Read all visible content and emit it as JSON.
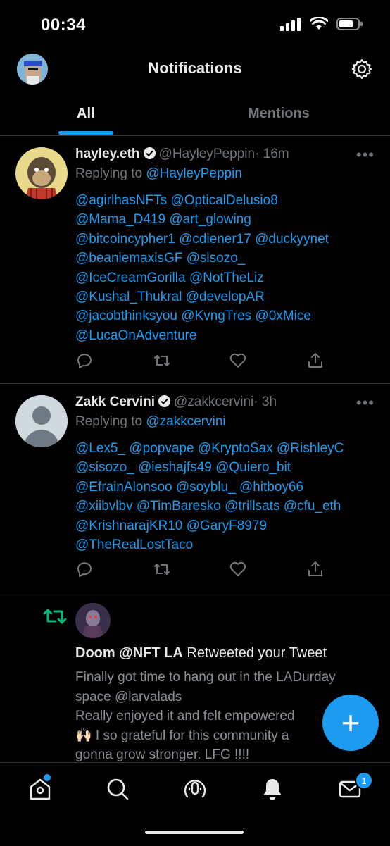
{
  "status_bar": {
    "time": "00:34"
  },
  "header": {
    "title": "Notifications"
  },
  "tabs": [
    {
      "label": "All"
    },
    {
      "label": "Mentions"
    }
  ],
  "tweets": [
    {
      "name": "hayley.eth",
      "handle": "@HayleyPeppin",
      "time": "· 16m",
      "replying_prefix": "Replying to ",
      "replying_to": "@HayleyPeppin",
      "text": "@agirlhasNFTs @OpticalDelusio8\n@Mama_D419 @art_glowing\n@bitcoincypher1 @cdiener17 @duckyynet\n@beaniemaxisGF @sisozo_\n@IceCreamGorilla @NotTheLiz\n@Kushal_Thukral @developAR\n@jacobthinksyou @KvngTres @0xMice\n@LucaOnAdventure"
    },
    {
      "name": "Zakk Cervini",
      "handle": "@zakkcervini",
      "time": "· 3h",
      "replying_prefix": "Replying to ",
      "replying_to": "@zakkcervini",
      "text": "@Lex5_ @popvape @KryptoSax @RishleyC\n@sisozo_ @ieshajfs49 @Quiero_bit\n@EfrainAlonsoo @soyblu_ @hitboy66\n@xiibvlbv @TimBaresko @trillsats @cfu_eth\n@KrishnarajKR10 @GaryF8979\n@TheRealLostTaco"
    }
  ],
  "retweet": {
    "user": "Doom @NFT LA",
    "action": " Retweeted your Tweet",
    "text": "Finally got time to hang out in the LADurday\nspace @larvalads\nReally enjoyed it and felt empowered\n🙌🏻 I  so grateful for this community a\ngonna grow stronger. LFG !!!!"
  },
  "bottom_nav": {
    "items": [
      "home-icon",
      "search-icon",
      "spaces-icon",
      "notifications-icon",
      "messages-icon"
    ],
    "messages_badge": "1"
  },
  "colors": {
    "accent": "#1d9bf0",
    "retweet": "#00ba7c",
    "background": "#000000"
  }
}
